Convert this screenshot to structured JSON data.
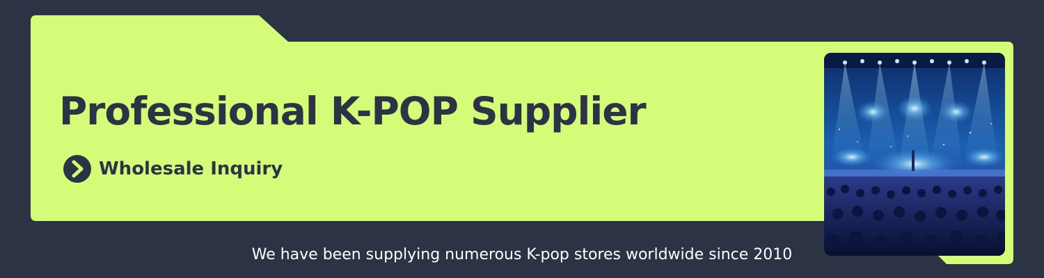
{
  "banner": {
    "headline": "Professional K-POP Supplier",
    "cta_label": "Wholesale Inquiry",
    "tagline": "We have been supplying numerous K-pop stores worldwide since 2010",
    "cta_icon": "chevron-right-circle-icon"
  },
  "colors": {
    "background": "#2b3345",
    "accent": "#d4fc79",
    "text_dark": "#2b3345",
    "text_light": "#ffffff"
  }
}
